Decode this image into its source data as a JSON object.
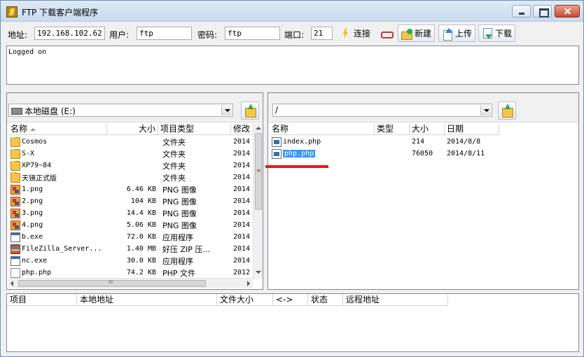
{
  "window": {
    "title": "FTP 下载客户端程序"
  },
  "toolbar": {
    "address_label": "地址:",
    "address_value": "192.168.102.62",
    "user_label": "用户:",
    "user_value": "ftp",
    "password_label": "密码:",
    "password_value": "ftp",
    "port_label": "端口:",
    "port_value": "21",
    "connect_label": "连接",
    "new_label": "新建",
    "upload_label": "上传",
    "download_label": "下载"
  },
  "log": {
    "text": "Logged on"
  },
  "local": {
    "drive": "本地磁盘 (E:)",
    "columns": [
      "名称",
      "大小",
      "项目类型",
      "修改"
    ],
    "files": [
      {
        "name": "Cosmos",
        "size": "",
        "type": "文件夹",
        "modified": "2014",
        "icon": "folder-icon"
      },
      {
        "name": "S-X",
        "size": "",
        "type": "文件夹",
        "modified": "2014",
        "icon": "folder-icon"
      },
      {
        "name": "XP79~84",
        "size": "",
        "type": "文件夹",
        "modified": "2014",
        "icon": "folder-icon"
      },
      {
        "name": "天镜正式版",
        "size": "",
        "type": "文件夹",
        "modified": "2014",
        "icon": "folder-icon"
      },
      {
        "name": "1.png",
        "size": "6.46 KB",
        "type": "PNG 图像",
        "modified": "2014",
        "icon": "png-icon"
      },
      {
        "name": "2.png",
        "size": "104 KB",
        "type": "PNG 图像",
        "modified": "2014",
        "icon": "png-icon"
      },
      {
        "name": "3.png",
        "size": "14.4 KB",
        "type": "PNG 图像",
        "modified": "2014",
        "icon": "png-icon"
      },
      {
        "name": "4.png",
        "size": "5.06 KB",
        "type": "PNG 图像",
        "modified": "2014",
        "icon": "png-icon"
      },
      {
        "name": "b.exe",
        "size": "72.0 KB",
        "type": "应用程序",
        "modified": "2014",
        "icon": "exe-icon"
      },
      {
        "name": "FileZilla_Server...",
        "size": "1.40 MB",
        "type": "好压 ZIP 压...",
        "modified": "2014",
        "icon": "zip-icon"
      },
      {
        "name": "nc.exe",
        "size": "30.0 KB",
        "type": "应用程序",
        "modified": "2014",
        "icon": "exe-icon"
      },
      {
        "name": "php.php",
        "size": "74.2 KB",
        "type": "PHP 文件",
        "modified": "2012",
        "icon": "php-file-icon"
      }
    ]
  },
  "remote": {
    "path": "/",
    "columns": [
      "名称",
      "类型",
      "大小",
      "日期"
    ],
    "files": [
      {
        "name": "index.php",
        "type": "",
        "size": "214",
        "date": "2014/8/8",
        "selected": false
      },
      {
        "name": "php.php",
        "type": "",
        "size": "76050",
        "date": "2014/8/11",
        "selected": true
      }
    ]
  },
  "queue": {
    "columns": [
      "项目",
      "本地地址",
      "文件大小",
      "<->",
      "状态",
      "远程地址"
    ]
  },
  "colors": {
    "selection": "#3399ff",
    "annotation_line": "#e21b1b"
  }
}
